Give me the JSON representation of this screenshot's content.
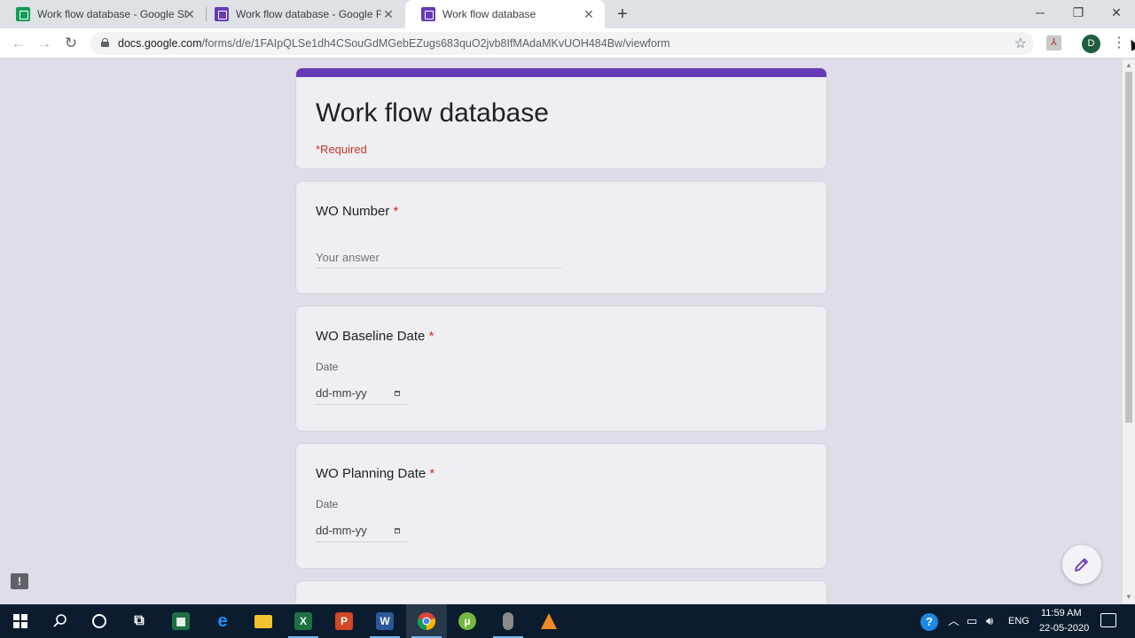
{
  "browser": {
    "tabs": [
      {
        "title": "Work flow database - Google Sheets",
        "favicon": "sheets-icon"
      },
      {
        "title": "Work flow database - Google Forms",
        "favicon": "forms-icon"
      },
      {
        "title": "Work flow database",
        "favicon": "forms-icon"
      }
    ],
    "active_tab": 2,
    "url_host": "docs.google.com",
    "url_path": "/forms/d/e/1FAIpQLSe1dh4CSouGdMGebEZugs683quO2jvb8IfMAdaMKvUOH484Bw/viewform",
    "profile_initial": "D"
  },
  "form": {
    "title": "Work flow database",
    "required_note": "*Required",
    "questions": [
      {
        "title": "WO Number",
        "required_mark": "*",
        "placeholder": "Your answer"
      },
      {
        "title": "WO Baseline Date",
        "required_mark": "*",
        "date_label": "Date",
        "date_placeholder": "dd-mm-yy"
      },
      {
        "title": "WO Planning Date",
        "required_mark": "*",
        "date_label": "Date",
        "date_placeholder": "dd-mm-yy"
      }
    ]
  },
  "taskbar": {
    "apps": [
      "windows-start",
      "search",
      "cortana",
      "task-view",
      "excel-sheet",
      "edge",
      "file-explorer",
      "excel",
      "powerpoint",
      "word",
      "chrome",
      "utorrent",
      "voice-recorder",
      "vlc"
    ],
    "tray": {
      "language": "ENG",
      "time": "11:59 AM",
      "date": "22-05-2020"
    }
  },
  "colors": {
    "accent": "#673ab7",
    "required": "#d93025",
    "page_bg": "#e0dde8"
  }
}
